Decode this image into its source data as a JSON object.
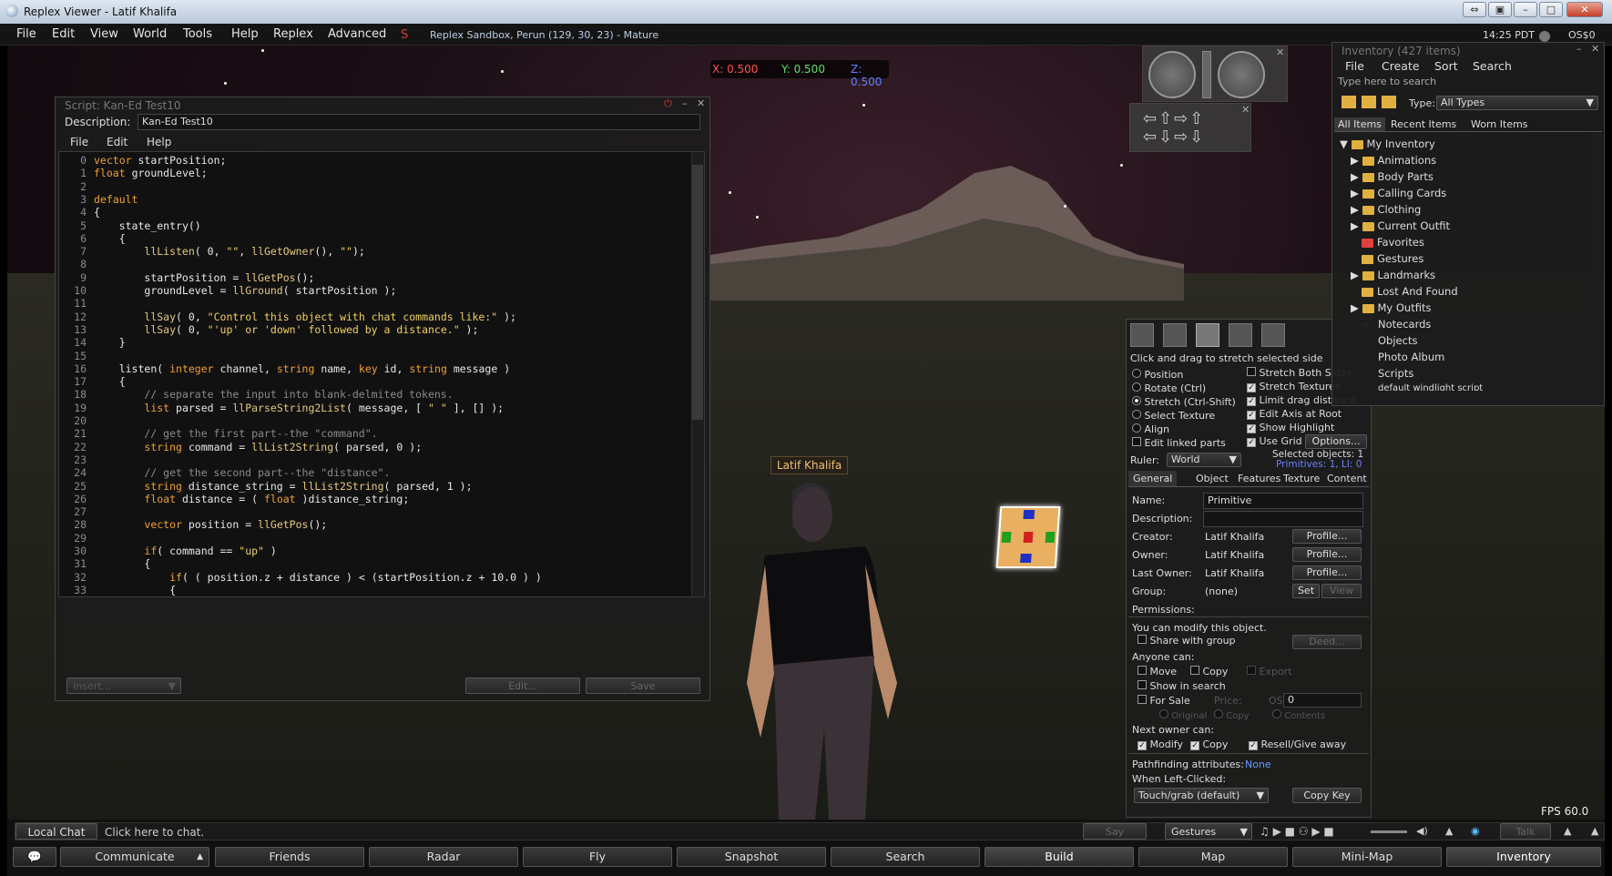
{
  "window": {
    "title": "Replex Viewer - Latif Khalifa"
  },
  "menu": {
    "items": [
      "File",
      "Edit",
      "View",
      "World",
      "Tools",
      "Help",
      "Replex",
      "Advanced"
    ],
    "location": "Replex Sandbox, Perun (129, 30, 23) - Mature",
    "clock": "14:25 PDT",
    "balance": "OS$0"
  },
  "coords": {
    "x": "X: 0.500",
    "y": "Y: 0.500",
    "z": "Z: 0.500"
  },
  "script": {
    "title": "Script: Kan-Ed Test10",
    "description_label": "Description:",
    "description": "Kan-Ed Test10",
    "menu": [
      "File",
      "Edit",
      "Help"
    ],
    "lines": [
      {
        "n": "0",
        "t": "vector startPosition;"
      },
      {
        "n": "1",
        "t": "float groundLevel;"
      },
      {
        "n": "2",
        "t": ""
      },
      {
        "n": "3",
        "t": "default"
      },
      {
        "n": "4",
        "t": "{"
      },
      {
        "n": "5",
        "t": "    state_entry()"
      },
      {
        "n": "6",
        "t": "    {"
      },
      {
        "n": "7",
        "t": "        llListen( 0, \"\", llGetOwner(), \"\");"
      },
      {
        "n": "8",
        "t": ""
      },
      {
        "n": "9",
        "t": "        startPosition = llGetPos();"
      },
      {
        "n": "10",
        "t": "        groundLevel = llGround( startPosition );"
      },
      {
        "n": "11",
        "t": ""
      },
      {
        "n": "12",
        "t": "        llSay( 0, \"Control this object with chat commands like:\" );"
      },
      {
        "n": "13",
        "t": "        llSay( 0, \"'up' or 'down' followed by a distance.\" );"
      },
      {
        "n": "14",
        "t": "    }"
      },
      {
        "n": "15",
        "t": ""
      },
      {
        "n": "16",
        "t": "    listen( integer channel, string name, key id, string message )"
      },
      {
        "n": "17",
        "t": "    {"
      },
      {
        "n": "18",
        "t": "        // separate the input into blank-delmited tokens."
      },
      {
        "n": "19",
        "t": "        list parsed = llParseString2List( message, [ \" \" ], [] );"
      },
      {
        "n": "20",
        "t": ""
      },
      {
        "n": "21",
        "t": "        // get the first part--the \"command\"."
      },
      {
        "n": "22",
        "t": "        string command = llList2String( parsed, 0 );"
      },
      {
        "n": "23",
        "t": ""
      },
      {
        "n": "24",
        "t": "        // get the second part--the \"distance\"."
      },
      {
        "n": "25",
        "t": "        string distance_string = llList2String( parsed, 1 );"
      },
      {
        "n": "26",
        "t": "        float distance = ( float )distance_string;"
      },
      {
        "n": "27",
        "t": ""
      },
      {
        "n": "28",
        "t": "        vector position = llGetPos();"
      },
      {
        "n": "29",
        "t": ""
      },
      {
        "n": "30",
        "t": "        if( command == \"up\" )"
      },
      {
        "n": "31",
        "t": "        {"
      },
      {
        "n": "32",
        "t": "            if( ( position.z + distance ) < (startPosition.z + 10.0 ) )"
      },
      {
        "n": "33",
        "t": "            {"
      }
    ],
    "insert_placeholder": "Insert...",
    "edit_label": "Edit...",
    "save_label": "Save"
  },
  "avatar": {
    "name": "Latif Khalifa"
  },
  "build": {
    "hint": "Click and drag to stretch selected side",
    "modes": [
      "Position",
      "Rotate (Ctrl)",
      "Stretch (Ctrl-Shift)",
      "Select Texture",
      "Align",
      "Edit linked parts"
    ],
    "options": [
      "Stretch Both Sides",
      "Stretch Textures",
      "Limit drag distance",
      "Edit Axis at Root",
      "Show Highlight",
      "Use Grid"
    ],
    "options_button": "Options...",
    "ruler_label": "Ruler:",
    "ruler": "World",
    "selected": "Selected objects: 1",
    "primitives": "Primitives: 1, LI: 0",
    "tabs": [
      "General",
      "Object",
      "Features",
      "Texture",
      "Content"
    ],
    "name_label": "Name:",
    "name": "Primitive",
    "desc_label": "Description:",
    "creator_label": "Creator:",
    "creator": "Latif Khalifa",
    "owner_label": "Owner:",
    "owner": "Latif Khalifa",
    "last_owner_label": "Last Owner:",
    "last_owner": "Latif Khalifa",
    "profile": "Profile...",
    "group_label": "Group:",
    "group": "(none)",
    "set": "Set",
    "view": "View",
    "permissions": "Permissions:",
    "can_modify": "You can modify this object.",
    "share": "Share with group",
    "deed": "Deed...",
    "anyone": "Anyone can:",
    "move": "Move",
    "copy": "Copy",
    "export": "Export",
    "show_search": "Show in search",
    "for_sale": "For Sale",
    "price_label": "Price:",
    "currency": "OS",
    "price": "0",
    "original": "Original",
    "copy2": "Copy",
    "contents": "Contents",
    "next_owner": "Next owner can:",
    "modify": "Modify",
    "copy3": "Copy",
    "resell": "Resell/Give away",
    "pathfinding": "Pathfinding attributes:",
    "pathfinding_val": "None",
    "left_click": "When Left-Clicked:",
    "left_click_val": "Touch/grab (default)",
    "copy_key": "Copy Key"
  },
  "inventory": {
    "title": "Inventory (427 items)",
    "menu": [
      "File",
      "Create",
      "Sort",
      "Search"
    ],
    "search_placeholder": "Type here to search",
    "type_label": "Type:",
    "type": "All Types",
    "tabs": [
      "All Items",
      "Recent Items",
      "Worn Items"
    ],
    "root": "My Inventory",
    "items": [
      "Animations",
      "Body Parts",
      "Calling Cards",
      "Clothing",
      "Current Outfit",
      "Favorites",
      "Gestures",
      "Landmarks",
      "Lost And Found",
      "My Outfits",
      "Notecards",
      "Objects",
      "Photo Album",
      "Scripts",
      "default windlight script"
    ]
  },
  "fps": "FPS 60.0",
  "chat": {
    "channel": "Local Chat",
    "placeholder": "Click here to chat.",
    "say": "Say",
    "gestures": "Gestures",
    "talk": "Talk"
  },
  "toolbar": {
    "communicate": "Communicate",
    "friends": "Friends",
    "radar": "Radar",
    "fly": "Fly",
    "snapshot": "Snapshot",
    "search": "Search",
    "build": "Build",
    "map": "Map",
    "minimap": "Mini-Map",
    "inventory": "Inventory"
  }
}
